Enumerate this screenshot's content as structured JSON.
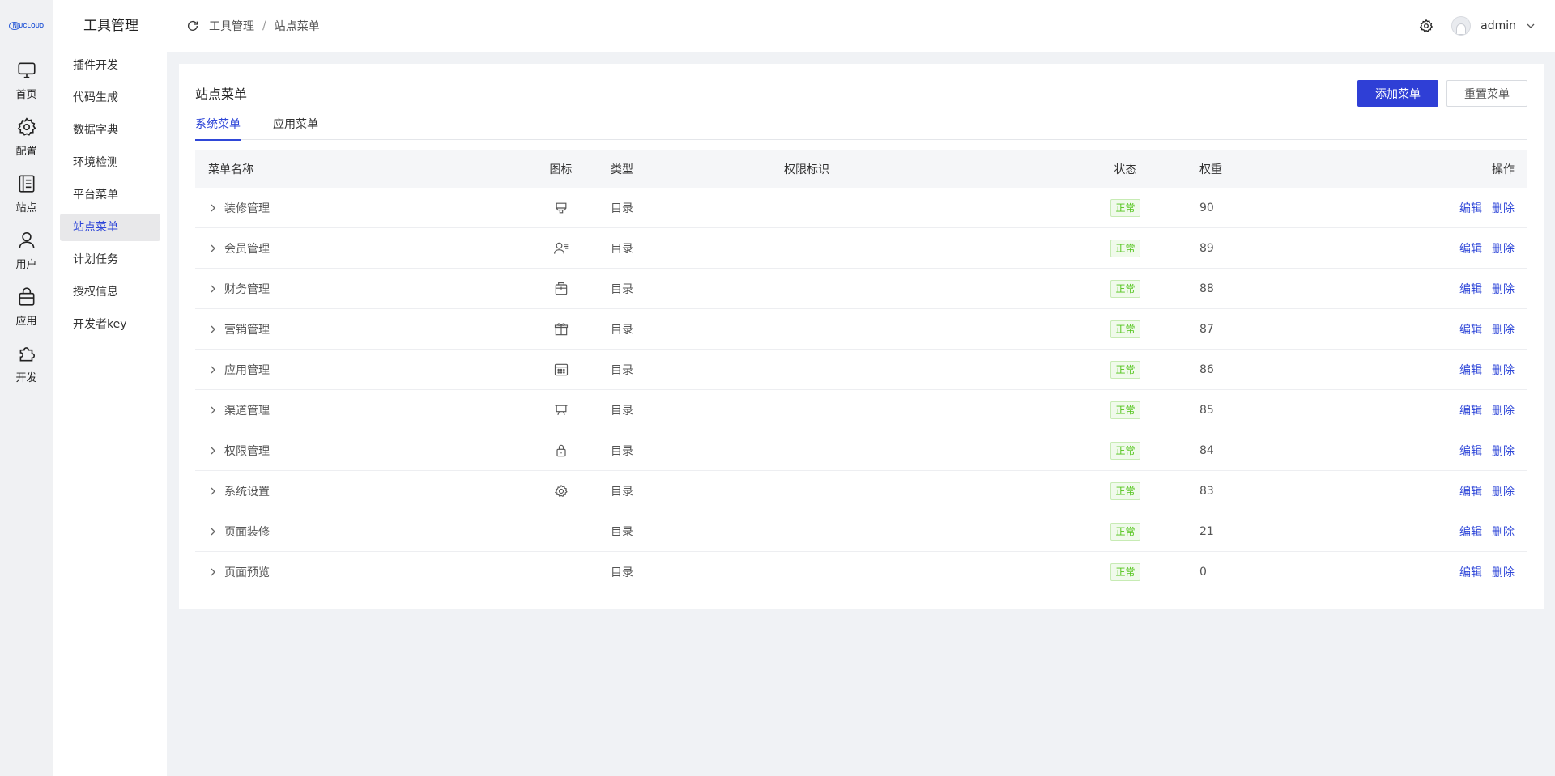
{
  "logo_text": "NIUCLOUD",
  "rail": [
    {
      "label": "首页",
      "icon": "monitor-icon"
    },
    {
      "label": "配置",
      "icon": "gear-icon"
    },
    {
      "label": "站点",
      "icon": "document-icon"
    },
    {
      "label": "用户",
      "icon": "user-icon"
    },
    {
      "label": "应用",
      "icon": "bag-icon"
    },
    {
      "label": "开发",
      "icon": "puzzle-icon"
    }
  ],
  "subnav": {
    "title": "工具管理",
    "items": [
      "插件开发",
      "代码生成",
      "数据字典",
      "环境检测",
      "平台菜单",
      "站点菜单",
      "计划任务",
      "授权信息",
      "开发者key"
    ],
    "active_index": 5
  },
  "header": {
    "breadcrumb": [
      "工具管理",
      "站点菜单"
    ],
    "separator": "/",
    "user": "admin"
  },
  "card": {
    "title": "站点菜单",
    "add_button": "添加菜单",
    "reset_button": "重置菜单",
    "tabs": [
      "系统菜单",
      "应用菜单"
    ]
  },
  "table": {
    "columns": [
      "菜单名称",
      "图标",
      "类型",
      "权限标识",
      "状态",
      "权重",
      "操作"
    ],
    "rows": [
      {
        "name": "装修管理",
        "icon": "brush-icon",
        "type": "目录",
        "perm": "",
        "status": "正常",
        "weight": "90"
      },
      {
        "name": "会员管理",
        "icon": "member-icon",
        "type": "目录",
        "perm": "",
        "status": "正常",
        "weight": "89"
      },
      {
        "name": "财务管理",
        "icon": "wallet-icon",
        "type": "目录",
        "perm": "",
        "status": "正常",
        "weight": "88"
      },
      {
        "name": "营销管理",
        "icon": "gift-icon",
        "type": "目录",
        "perm": "",
        "status": "正常",
        "weight": "87"
      },
      {
        "name": "应用管理",
        "icon": "grid-icon",
        "type": "目录",
        "perm": "",
        "status": "正常",
        "weight": "86"
      },
      {
        "name": "渠道管理",
        "icon": "board-icon",
        "type": "目录",
        "perm": "",
        "status": "正常",
        "weight": "85"
      },
      {
        "name": "权限管理",
        "icon": "lock-icon",
        "type": "目录",
        "perm": "",
        "status": "正常",
        "weight": "84"
      },
      {
        "name": "系统设置",
        "icon": "settings-icon",
        "type": "目录",
        "perm": "",
        "status": "正常",
        "weight": "83"
      },
      {
        "name": "页面装修",
        "icon": "",
        "type": "目录",
        "perm": "",
        "status": "正常",
        "weight": "21"
      },
      {
        "name": "页面预览",
        "icon": "",
        "type": "目录",
        "perm": "",
        "status": "正常",
        "weight": "0"
      }
    ],
    "edit_label": "编辑",
    "delete_label": "删除"
  },
  "colors": {
    "primary": "#2f3fd6",
    "link": "#2f47d8",
    "success": "#52c41a"
  }
}
